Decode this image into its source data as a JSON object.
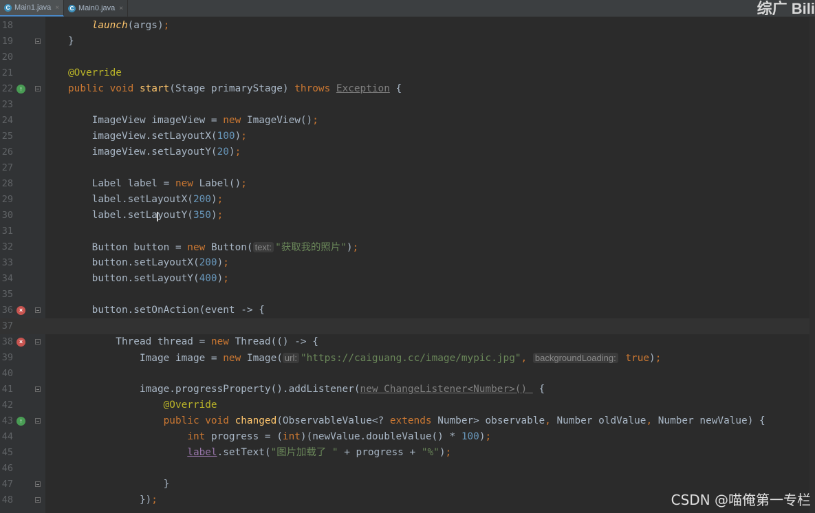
{
  "tabs": [
    {
      "name": "Main1.java",
      "active": true,
      "icon": "java-class-icon"
    },
    {
      "name": "Main0.java",
      "active": false,
      "icon": "java-class-icon"
    }
  ],
  "close_glyph": "×",
  "watermark_top": "综广  Bili",
  "watermark_bottom": "CSDN @喵俺第一专栏",
  "colors": {
    "background": "#2b2b2b",
    "keyword": "#cc7832",
    "number": "#6897bb",
    "string": "#6a8759",
    "annotation": "#bbb529",
    "method": "#ffc66d"
  },
  "lines": [
    {
      "n": "18",
      "icon": "",
      "fold": false,
      "segs": [
        [
          "",
          "    "
        ],
        [
          "fn it",
          "launch"
        ],
        [
          "",
          "(args)"
        ],
        [
          "kw",
          ";"
        ]
      ]
    },
    {
      "n": "19",
      "icon": "",
      "fold": true,
      "segs": [
        [
          "",
          "}"
        ]
      ]
    },
    {
      "n": "20",
      "icon": "",
      "fold": false,
      "segs": []
    },
    {
      "n": "21",
      "icon": "",
      "fold": false,
      "segs": [
        [
          "ann",
          "@Override"
        ]
      ]
    },
    {
      "n": "22",
      "icon": "override-icon",
      "fold": true,
      "segs": [
        [
          "kw",
          "public void "
        ],
        [
          "fn",
          "start"
        ],
        [
          "",
          "(Stage primaryStage) "
        ],
        [
          "kw",
          "throws "
        ],
        [
          "ignored",
          "Exception"
        ],
        [
          "",
          " {"
        ]
      ]
    },
    {
      "n": "23",
      "icon": "",
      "fold": false,
      "segs": []
    },
    {
      "n": "24",
      "icon": "",
      "fold": false,
      "segs": [
        [
          "",
          "    ImageView imageView = "
        ],
        [
          "kw",
          "new "
        ],
        [
          "",
          "ImageView()"
        ],
        [
          "kw",
          ";"
        ]
      ]
    },
    {
      "n": "25",
      "icon": "",
      "fold": false,
      "segs": [
        [
          "",
          "    imageView.setLayoutX("
        ],
        [
          "num",
          "100"
        ],
        [
          "",
          ")"
        ],
        [
          "kw",
          ";"
        ]
      ]
    },
    {
      "n": "26",
      "icon": "",
      "fold": false,
      "segs": [
        [
          "",
          "    imageView.setLayoutY("
        ],
        [
          "num",
          "20"
        ],
        [
          "",
          ")"
        ],
        [
          "kw",
          ";"
        ]
      ]
    },
    {
      "n": "27",
      "icon": "",
      "fold": false,
      "segs": []
    },
    {
      "n": "28",
      "icon": "",
      "fold": false,
      "segs": [
        [
          "",
          "    Label label = "
        ],
        [
          "kw",
          "new "
        ],
        [
          "",
          "Label()"
        ],
        [
          "kw",
          ";"
        ]
      ]
    },
    {
      "n": "29",
      "icon": "",
      "fold": false,
      "segs": [
        [
          "",
          "    label.setLayoutX("
        ],
        [
          "num",
          "200"
        ],
        [
          "",
          ")"
        ],
        [
          "kw",
          ";"
        ]
      ]
    },
    {
      "n": "30",
      "icon": "",
      "fold": false,
      "segs": [
        [
          "",
          "    label.setLayoutY("
        ],
        [
          "num",
          "350"
        ],
        [
          "",
          ")"
        ],
        [
          "kw",
          ";"
        ]
      ]
    },
    {
      "n": "31",
      "icon": "",
      "fold": false,
      "segs": []
    },
    {
      "n": "32",
      "icon": "",
      "fold": false,
      "segs": [
        [
          "",
          "    Button button = "
        ],
        [
          "kw",
          "new "
        ],
        [
          "",
          "Button("
        ],
        [
          "hint",
          "text:"
        ],
        [
          "str",
          "\"获取我的照片\""
        ],
        [
          "",
          ")"
        ],
        [
          "kw",
          ";"
        ]
      ]
    },
    {
      "n": "33",
      "icon": "",
      "fold": false,
      "segs": [
        [
          "",
          "    button.setLayoutX("
        ],
        [
          "num",
          "200"
        ],
        [
          "",
          ")"
        ],
        [
          "kw",
          ";"
        ]
      ]
    },
    {
      "n": "34",
      "icon": "",
      "fold": false,
      "segs": [
        [
          "",
          "    button.setLayoutY("
        ],
        [
          "num",
          "400"
        ],
        [
          "",
          ")"
        ],
        [
          "kw",
          ";"
        ]
      ]
    },
    {
      "n": "35",
      "icon": "",
      "fold": false,
      "segs": []
    },
    {
      "n": "36",
      "icon": "error-icon",
      "fold": true,
      "segs": [
        [
          "",
          "    button.setOnAction(event -> {"
        ]
      ]
    },
    {
      "n": "37",
      "icon": "",
      "fold": false,
      "current": true,
      "segs": []
    },
    {
      "n": "38",
      "icon": "error-icon",
      "fold": true,
      "segs": [
        [
          "",
          "        Thread thread = "
        ],
        [
          "kw",
          "new "
        ],
        [
          "",
          "Thread(() -> {"
        ]
      ]
    },
    {
      "n": "39",
      "icon": "",
      "fold": false,
      "segs": [
        [
          "",
          "            Image image = "
        ],
        [
          "kw",
          "new "
        ],
        [
          "",
          "Image("
        ],
        [
          "hint",
          "url:"
        ],
        [
          "str",
          "\"https://caiguang.cc/image/mypic.jpg\""
        ],
        [
          "kw",
          ", "
        ],
        [
          "hint",
          "backgroundLoading:"
        ],
        [
          "kw",
          " true"
        ],
        [
          "",
          ")"
        ],
        [
          "kw",
          ";"
        ]
      ]
    },
    {
      "n": "40",
      "icon": "",
      "fold": false,
      "segs": []
    },
    {
      "n": "41",
      "icon": "",
      "fold": true,
      "segs": [
        [
          "",
          "            image.progressProperty().addListener("
        ],
        [
          "ignored",
          "new ChangeListener<Number>() "
        ],
        [
          "",
          " {"
        ]
      ]
    },
    {
      "n": "42",
      "icon": "",
      "fold": false,
      "segs": [
        [
          "ann",
          "                @Override"
        ]
      ]
    },
    {
      "n": "43",
      "icon": "override-icon",
      "fold": true,
      "segs": [
        [
          "kw",
          "                public void "
        ],
        [
          "fn",
          "changed"
        ],
        [
          "",
          "(ObservableValue<? "
        ],
        [
          "kw",
          "extends "
        ],
        [
          "",
          "Number> observable"
        ],
        [
          "kw",
          ", "
        ],
        [
          "",
          "Number oldValue"
        ],
        [
          "kw",
          ", "
        ],
        [
          "",
          "Number newValue) {"
        ]
      ]
    },
    {
      "n": "44",
      "icon": "",
      "fold": false,
      "segs": [
        [
          "kw",
          "                    int "
        ],
        [
          "",
          "progress = ("
        ],
        [
          "kw",
          "int"
        ],
        [
          "",
          ")(newValue.doubleValue() * "
        ],
        [
          "num",
          "100"
        ],
        [
          "",
          ")"
        ],
        [
          "kw",
          ";"
        ]
      ]
    },
    {
      "n": "45",
      "icon": "",
      "fold": false,
      "segs": [
        [
          "",
          "                    "
        ],
        [
          "field",
          "label"
        ],
        [
          "",
          ".setText("
        ],
        [
          "str",
          "\"图片加载了 \""
        ],
        [
          "",
          " + progress + "
        ],
        [
          "str",
          "\"%\""
        ],
        [
          "",
          ")"
        ],
        [
          "kw",
          ";"
        ]
      ]
    },
    {
      "n": "46",
      "icon": "",
      "fold": false,
      "segs": []
    },
    {
      "n": "47",
      "icon": "",
      "fold": true,
      "segs": [
        [
          "",
          "                }"
        ]
      ]
    },
    {
      "n": "48",
      "icon": "",
      "fold": true,
      "segs": [
        [
          "",
          "            })"
        ],
        [
          "kw",
          ";"
        ]
      ]
    }
  ]
}
